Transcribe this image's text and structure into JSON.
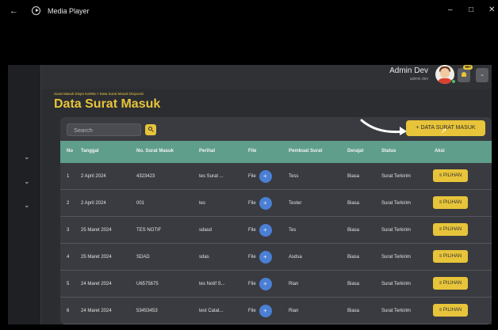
{
  "window": {
    "title": "Media Player",
    "back_glyph": "←",
    "minimize_glyph": "–",
    "maximize_glyph": "□",
    "close_glyph": "✕"
  },
  "sidebar": {
    "chevron": "⌄",
    "items": [
      {
        "icon": "chevron-down-icon"
      },
      {
        "icon": "chevron-down-icon"
      },
      {
        "icon": "chevron-down-icon"
      }
    ]
  },
  "user": {
    "name": "Admin Dev",
    "role": "admin dev",
    "notification_count": "99+",
    "menu_glyph": "⌄"
  },
  "page": {
    "breadcrumb": "Surat Masuk Dispo Ka/Wa > Data Surat Masuk Disposisi",
    "title": "Data Surat Masuk"
  },
  "search": {
    "placeholder": "Search"
  },
  "add_button": {
    "label": "+ DATA SURAT MASUK"
  },
  "table": {
    "columns": [
      "No",
      "Tanggal",
      "No. Surat Masuk",
      "Perihal",
      "File",
      "Pembuat Surat",
      "Derajat",
      "Status",
      "Aksi"
    ],
    "action_label": "≡ PILIHAN",
    "file_label": "File",
    "rows": [
      {
        "no": "1",
        "tanggal": "2 April 2024",
        "no_surat": "4323423",
        "perihal": "tes Surat ...",
        "pembuat": "Tess",
        "derajat": "Biasa",
        "status": "Surat Terkirim"
      },
      {
        "no": "2",
        "tanggal": "2 April 2024",
        "no_surat": "001",
        "perihal": "tes",
        "pembuat": "Tester",
        "derajat": "Biasa",
        "status": "Surat Terkirim"
      },
      {
        "no": "3",
        "tanggal": "25 Maret 2024",
        "no_surat": "TES NOTIF",
        "perihal": "sdasd",
        "pembuat": "Tes",
        "derajat": "Biasa",
        "status": "Surat Terkirim"
      },
      {
        "no": "4",
        "tanggal": "25 Maret 2024",
        "no_surat": "SDAD",
        "perihal": "sdas",
        "pembuat": "Asdsa",
        "derajat": "Biasa",
        "status": "Surat Terkirim"
      },
      {
        "no": "5",
        "tanggal": "24 Maret 2024",
        "no_surat": "U6575675",
        "perihal": "tes Notif S...",
        "pembuat": "Rian",
        "derajat": "Biasa",
        "status": "Surat Terkirim"
      },
      {
        "no": "6",
        "tanggal": "24 Maret 2024",
        "no_surat": "53453453",
        "perihal": "test Catat...",
        "pembuat": "Rian",
        "derajat": "Biasa",
        "status": "Surat Terkirim"
      }
    ]
  },
  "colors": {
    "accent": "#e7c43a",
    "table_header": "#5f9e8a",
    "file_badge": "#4a7fd4"
  }
}
